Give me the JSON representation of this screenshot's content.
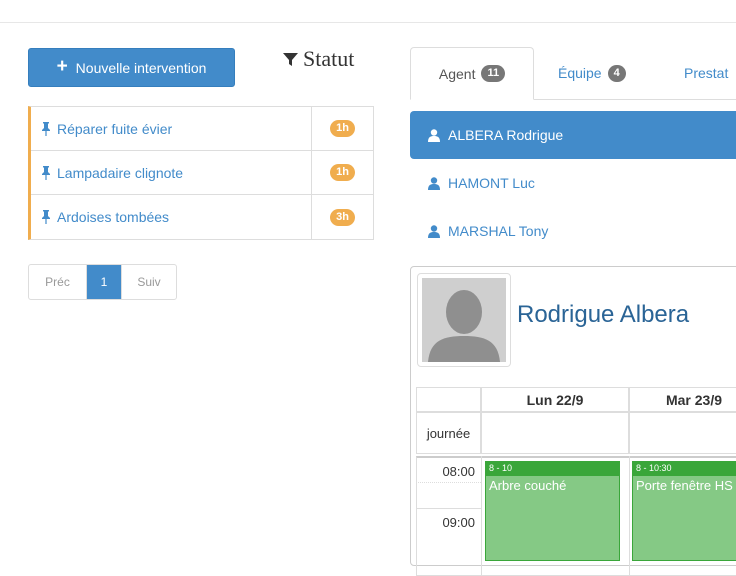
{
  "toolbar": {
    "new_label": "Nouvelle intervention",
    "statut_label": "Statut"
  },
  "tasks": [
    {
      "label": "Réparer fuite évier",
      "duration": "1h"
    },
    {
      "label": "Lampadaire clignote",
      "duration": "1h"
    },
    {
      "label": "Ardoises tombées",
      "duration": "3h"
    }
  ],
  "pager": {
    "prev": "Préc",
    "current": "1",
    "next": "Suiv"
  },
  "tabs": [
    {
      "label": "Agent",
      "count": "11"
    },
    {
      "label": "Équipe",
      "count": "4"
    },
    {
      "label": "Prestat"
    }
  ],
  "agents": [
    {
      "name": "ALBERA Rodrigue"
    },
    {
      "name": "HAMONT Luc"
    },
    {
      "name": "MARSHAL Tony"
    }
  ],
  "profile": {
    "name": "Rodrigue Albera"
  },
  "calendar": {
    "days": [
      "Lun 22/9",
      "Mar 23/9"
    ],
    "allday_label": "journée",
    "times": [
      "08:00",
      "09:00"
    ],
    "events": [
      {
        "time": "8 - 10",
        "title": "Arbre couché"
      },
      {
        "time": "8 - 10:30",
        "title": "Porte fenêtre HS"
      }
    ]
  },
  "colors": {
    "primary": "#428bca",
    "warning": "#f0ad4e",
    "event": "#85c985",
    "event_border": "#3aa63a"
  }
}
